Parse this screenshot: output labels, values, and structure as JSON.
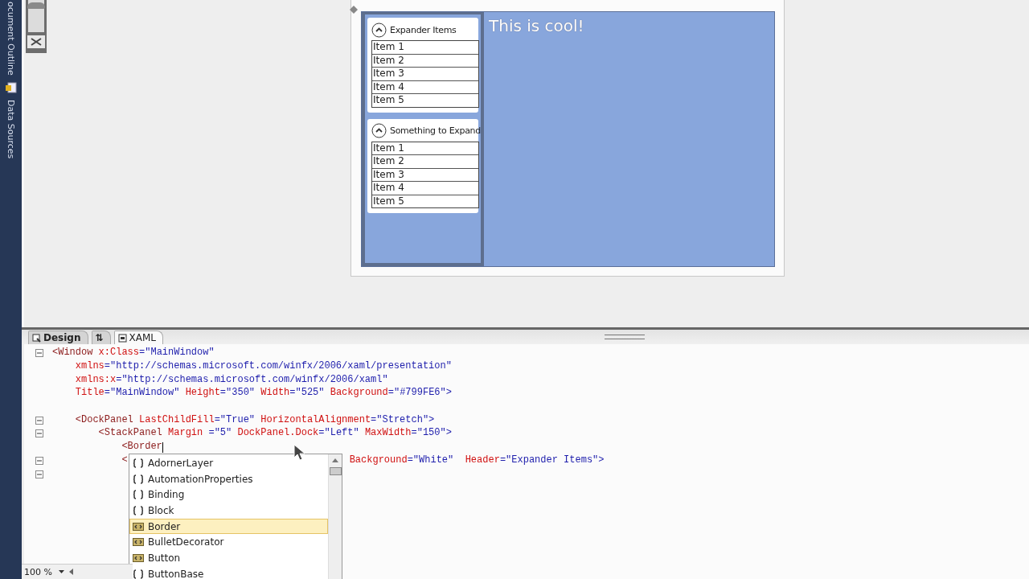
{
  "side_tabs": [
    {
      "label": "ocument Outline"
    },
    {
      "label": "Data Sources"
    }
  ],
  "zoom_slider": {
    "level": 0.9
  },
  "preview": {
    "expanders": [
      {
        "header": "Expander Items",
        "expanded": true,
        "items": [
          "Item 1",
          "Item 2",
          "Item 3",
          "Item 4",
          "Item 5"
        ]
      },
      {
        "header": "Something to Expand",
        "expanded": true,
        "items": [
          "Item 1",
          "Item 2",
          "Item 3",
          "Item 4",
          "Item 5"
        ]
      }
    ],
    "heading": "This is cool!"
  },
  "view_tabs": [
    {
      "label": "Design",
      "kind": "design",
      "selected": false
    },
    {
      "label": "⇅",
      "kind": "swap",
      "selected": false
    },
    {
      "label": "XAML",
      "kind": "xaml",
      "selected": true
    }
  ],
  "code_lines": [
    {
      "fold": true,
      "segments": [
        {
          "kind": "tag",
          "text": "<Window "
        },
        {
          "kind": "attr",
          "text": "x:Class"
        },
        {
          "kind": "value",
          "text": "=\"MainWindow\""
        }
      ]
    },
    {
      "fold": false,
      "segments": [
        {
          "kind": "attr",
          "text": "    xmlns"
        },
        {
          "kind": "value",
          "text": "=\"http://schemas.microsoft.com/winfx/2006/xaml/presentation\""
        }
      ]
    },
    {
      "fold": false,
      "segments": [
        {
          "kind": "attr",
          "text": "    xmlns:x"
        },
        {
          "kind": "value",
          "text": "=\"http://schemas.microsoft.com/winfx/2006/xaml\""
        }
      ]
    },
    {
      "fold": false,
      "segments": [
        {
          "kind": "attr",
          "text": "    Title"
        },
        {
          "kind": "value",
          "text": "=\"MainWindow\" "
        },
        {
          "kind": "attr",
          "text": "Height"
        },
        {
          "kind": "value",
          "text": "=\"350\" "
        },
        {
          "kind": "attr",
          "text": "Width"
        },
        {
          "kind": "value",
          "text": "=\"525\" "
        },
        {
          "kind": "attr",
          "text": "Background"
        },
        {
          "kind": "value",
          "text": "=\"#799FE6\">"
        }
      ]
    },
    {
      "fold": false
    },
    {
      "fold": true,
      "segments": [
        {
          "kind": "tag",
          "text": "    <DockPanel "
        },
        {
          "kind": "attr",
          "text": "LastChildFill"
        },
        {
          "kind": "value",
          "text": "=\"True\" "
        },
        {
          "kind": "attr",
          "text": "HorizontalAlignment"
        },
        {
          "kind": "value",
          "text": "=\"Stretch\">"
        }
      ]
    },
    {
      "fold": true,
      "segments": [
        {
          "kind": "tag",
          "text": "        <StackPanel "
        },
        {
          "kind": "attr",
          "text": "Margin"
        },
        {
          "kind": "value",
          "text": " =\"5\" "
        },
        {
          "kind": "attr",
          "text": "DockPanel.Dock"
        },
        {
          "kind": "value",
          "text": "=\"Left\" "
        },
        {
          "kind": "attr",
          "text": "MaxWidth"
        },
        {
          "kind": "value",
          "text": "=\"150\">"
        }
      ]
    },
    {
      "fold": false,
      "caret": true,
      "segments": [
        {
          "kind": "tag",
          "text": "            <Border"
        }
      ]
    },
    {
      "fold": true,
      "segments": [
        {
          "kind": "tag",
          "text": "            <"
        }
      ],
      "continuation": [
        {
          "kind": "attr",
          "text": "Background"
        },
        {
          "kind": "value",
          "text": "=\"White\"  "
        },
        {
          "kind": "attr",
          "text": "Header"
        },
        {
          "kind": "value",
          "text": "=\"Expander Items\">"
        }
      ]
    },
    {
      "fold": true
    }
  ],
  "completion": [
    {
      "kind": "namespace",
      "label": "AdornerLayer",
      "selected": false
    },
    {
      "kind": "namespace",
      "label": "AutomationProperties",
      "selected": false
    },
    {
      "kind": "namespace",
      "label": "Binding",
      "selected": false
    },
    {
      "kind": "namespace",
      "label": "Block",
      "selected": false
    },
    {
      "kind": "class",
      "label": "Border",
      "selected": true
    },
    {
      "kind": "class",
      "label": "BulletDecorator",
      "selected": false
    },
    {
      "kind": "class",
      "label": "Button",
      "selected": false
    },
    {
      "kind": "namespace",
      "label": "ButtonBase",
      "selected": false
    }
  ],
  "zoom": {
    "value": "100 %"
  }
}
